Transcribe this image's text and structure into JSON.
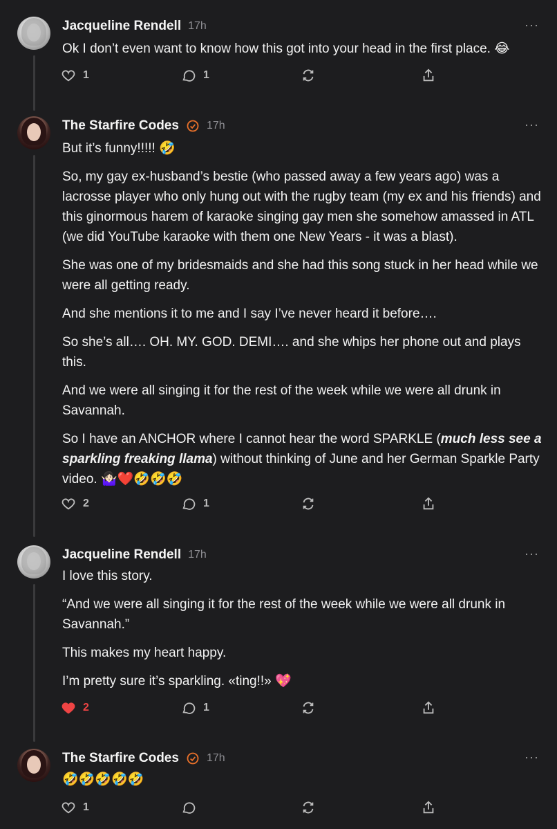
{
  "posts": [
    {
      "author": "Jacqueline Rendell",
      "time": "17h",
      "verified": false,
      "paragraphs": [
        "Ok I don’t even want to know how this got into your head in the first place. 😂"
      ],
      "likes": "1",
      "replies": "1",
      "liked": false
    },
    {
      "author": "The Starfire Codes",
      "time": "17h",
      "verified": true,
      "paragraphs": [
        "But it’s funny!!!!! 🤣",
        "So, my gay ex-husband’s bestie (who passed away a few years ago) was a lacrosse player who only hung out with the rugby team (my ex and his friends) and this ginormous harem of karaoke singing gay men she somehow amassed in ATL (we did YouTube karaoke with them one New Years - it was a blast).",
        "She was one of my bridesmaids and she had this song stuck in her head while we were all getting ready.",
        "And she mentions it to me and I say I’ve never heard it before….",
        "So she’s all…. OH. MY. GOD. DEMI…. and she whips her phone out and plays this.",
        "And we were all singing it for the rest of the week while we were all drunk in Savannah."
      ],
      "last_paragraph": {
        "before": "So I have an ANCHOR where I cannot hear the word SPARKLE (",
        "emphasis": "much less see a sparkling freaking llama",
        "after": ") without thinking of June and her German Sparkle Party video. 🤷🏻‍♀️❤️🤣🤣🤣"
      },
      "likes": "2",
      "replies": "1",
      "liked": false
    },
    {
      "author": "Jacqueline Rendell",
      "time": "17h",
      "verified": false,
      "paragraphs": [
        "I love this story.",
        "“And we were all singing it for the rest of the week while we were all drunk in Savannah.”",
        "This makes my heart happy.",
        "I’m pretty sure it’s sparkling. «ting!!» 💖"
      ],
      "likes": "2",
      "replies": "1",
      "liked": true
    },
    {
      "author": "The Starfire Codes",
      "time": "17h",
      "verified": true,
      "paragraphs": [
        "🤣🤣🤣🤣🤣"
      ],
      "likes": "1",
      "replies": "",
      "liked": false
    }
  ],
  "icons": {
    "more": "more-icon",
    "like": "heart-icon",
    "reply": "comment-icon",
    "repost": "repost-icon",
    "share": "share-icon",
    "verified": "verified-check-icon"
  },
  "colors": {
    "background": "#1d1d1f",
    "verified": "#e8702a",
    "liked": "#ef4444"
  },
  "more_label": "···"
}
